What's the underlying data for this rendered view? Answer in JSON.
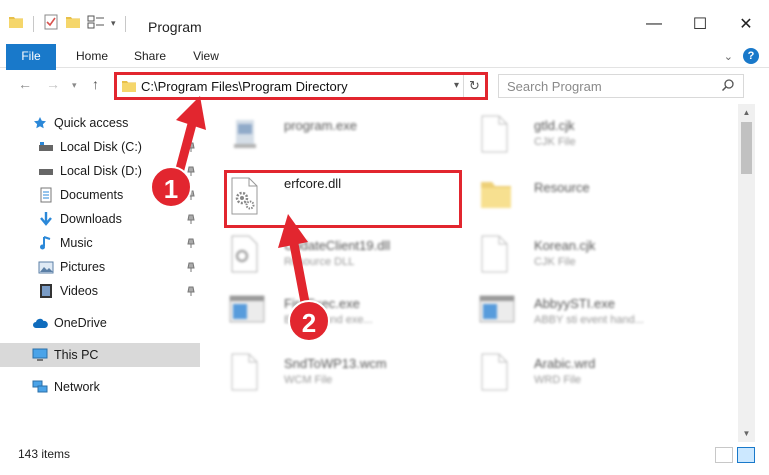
{
  "window": {
    "title": "Program",
    "minimize": "—",
    "maximize": "☐",
    "close": "✕"
  },
  "ribbon": {
    "tabs": [
      "File",
      "Home",
      "Share",
      "View"
    ],
    "help": "?"
  },
  "nav": {
    "back": "←",
    "forward": "→",
    "recent": "▾",
    "up": "↑",
    "address": "C:\\Program Files\\Program Directory",
    "address_dropdown": "▾",
    "refresh": "↻",
    "search_placeholder": "Search Program"
  },
  "sidebar": {
    "items": [
      {
        "label": "Quick access",
        "icon": "star-icon",
        "pinned": false
      },
      {
        "label": "Local Disk (C:)",
        "icon": "drive-icon",
        "pinned": true
      },
      {
        "label": "Local Disk (D:)",
        "icon": "drive-icon",
        "pinned": true
      },
      {
        "label": "Documents",
        "icon": "documents-icon",
        "pinned": true
      },
      {
        "label": "Downloads",
        "icon": "downloads-icon",
        "pinned": true
      },
      {
        "label": "Music",
        "icon": "music-icon",
        "pinned": true
      },
      {
        "label": "Pictures",
        "icon": "pictures-icon",
        "pinned": true
      },
      {
        "label": "Videos",
        "icon": "videos-icon",
        "pinned": true
      },
      {
        "label": "OneDrive",
        "icon": "cloud-icon",
        "pinned": false
      },
      {
        "label": "This PC",
        "icon": "computer-icon",
        "pinned": false,
        "selected": true
      },
      {
        "label": "Network",
        "icon": "network-icon",
        "pinned": false
      }
    ]
  },
  "files": [
    {
      "name": "program.exe",
      "type": "",
      "icon": "exe-icon",
      "blurred": true
    },
    {
      "name": "gtld.cjk",
      "type": "CJK File",
      "icon": "blank-file-icon",
      "blurred": true
    },
    {
      "name": "erfcore.dll",
      "type": "",
      "icon": "dll-gear-icon",
      "blurred": false,
      "highlighted": true
    },
    {
      "name": "Resource",
      "type": "",
      "icon": "folder-icon",
      "blurred": true
    },
    {
      "name": "UpdateClient19.dll",
      "type": "Resource DLL",
      "icon": "dll-gear-icon",
      "blurred": true
    },
    {
      "name": "Korean.cjk",
      "type": "CJK File",
      "icon": "blank-file-icon",
      "blurred": true
    },
    {
      "name": "FireExec.exe",
      "type": "Background exe...",
      "icon": "window-exe-icon",
      "blurred": true
    },
    {
      "name": "AbbyySTI.exe",
      "type": "ABBY sti event hand...",
      "icon": "window-exe-icon",
      "blurred": true
    },
    {
      "name": "SndToWP13.wcm",
      "type": "WCM File",
      "icon": "blank-file-icon",
      "blurred": true
    },
    {
      "name": "Arabic.wrd",
      "type": "WRD File",
      "icon": "blank-file-icon",
      "blurred": true
    }
  ],
  "annotations": {
    "step1": "1",
    "step2": "2",
    "color": "#e2262f"
  },
  "status": {
    "count": "143 items"
  },
  "colors": {
    "accent": "#1979ca",
    "selected_bg": "#d9d9d9",
    "highlight": "#e2262f"
  }
}
